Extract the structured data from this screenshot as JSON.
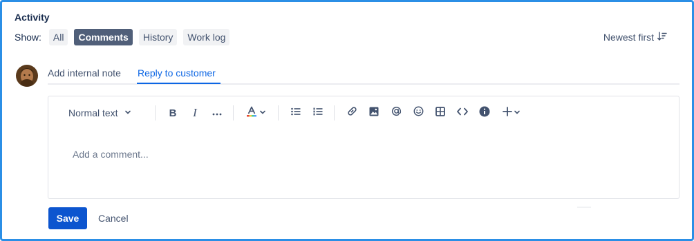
{
  "activity": {
    "title": "Activity",
    "show_label": "Show:",
    "filters": [
      {
        "label": "All",
        "active": false
      },
      {
        "label": "Comments",
        "active": true
      },
      {
        "label": "History",
        "active": false
      },
      {
        "label": "Work log",
        "active": false
      }
    ],
    "sort_label": "Newest first",
    "sort_icon": "sort-descending-icon"
  },
  "tabs": {
    "internal_note": "Add internal note",
    "reply_customer": "Reply to customer",
    "active": "reply_customer"
  },
  "editor": {
    "text_style": "Normal text",
    "placeholder": "Add a comment...",
    "toolbar_icons": [
      "bold-icon",
      "italic-icon",
      "more-formatting-icon",
      "text-color-icon",
      "bullet-list-icon",
      "numbered-list-icon",
      "link-icon",
      "image-icon",
      "mention-icon",
      "emoji-icon",
      "table-icon",
      "code-icon",
      "info-icon",
      "insert-plus-icon"
    ]
  },
  "actions": {
    "save": "Save",
    "cancel": "Cancel"
  },
  "colors": {
    "primary": "#0c55cf",
    "active_tab": "#0c66e4",
    "active_filter_bg": "#505f79",
    "frame_border": "#2b8fe6"
  }
}
